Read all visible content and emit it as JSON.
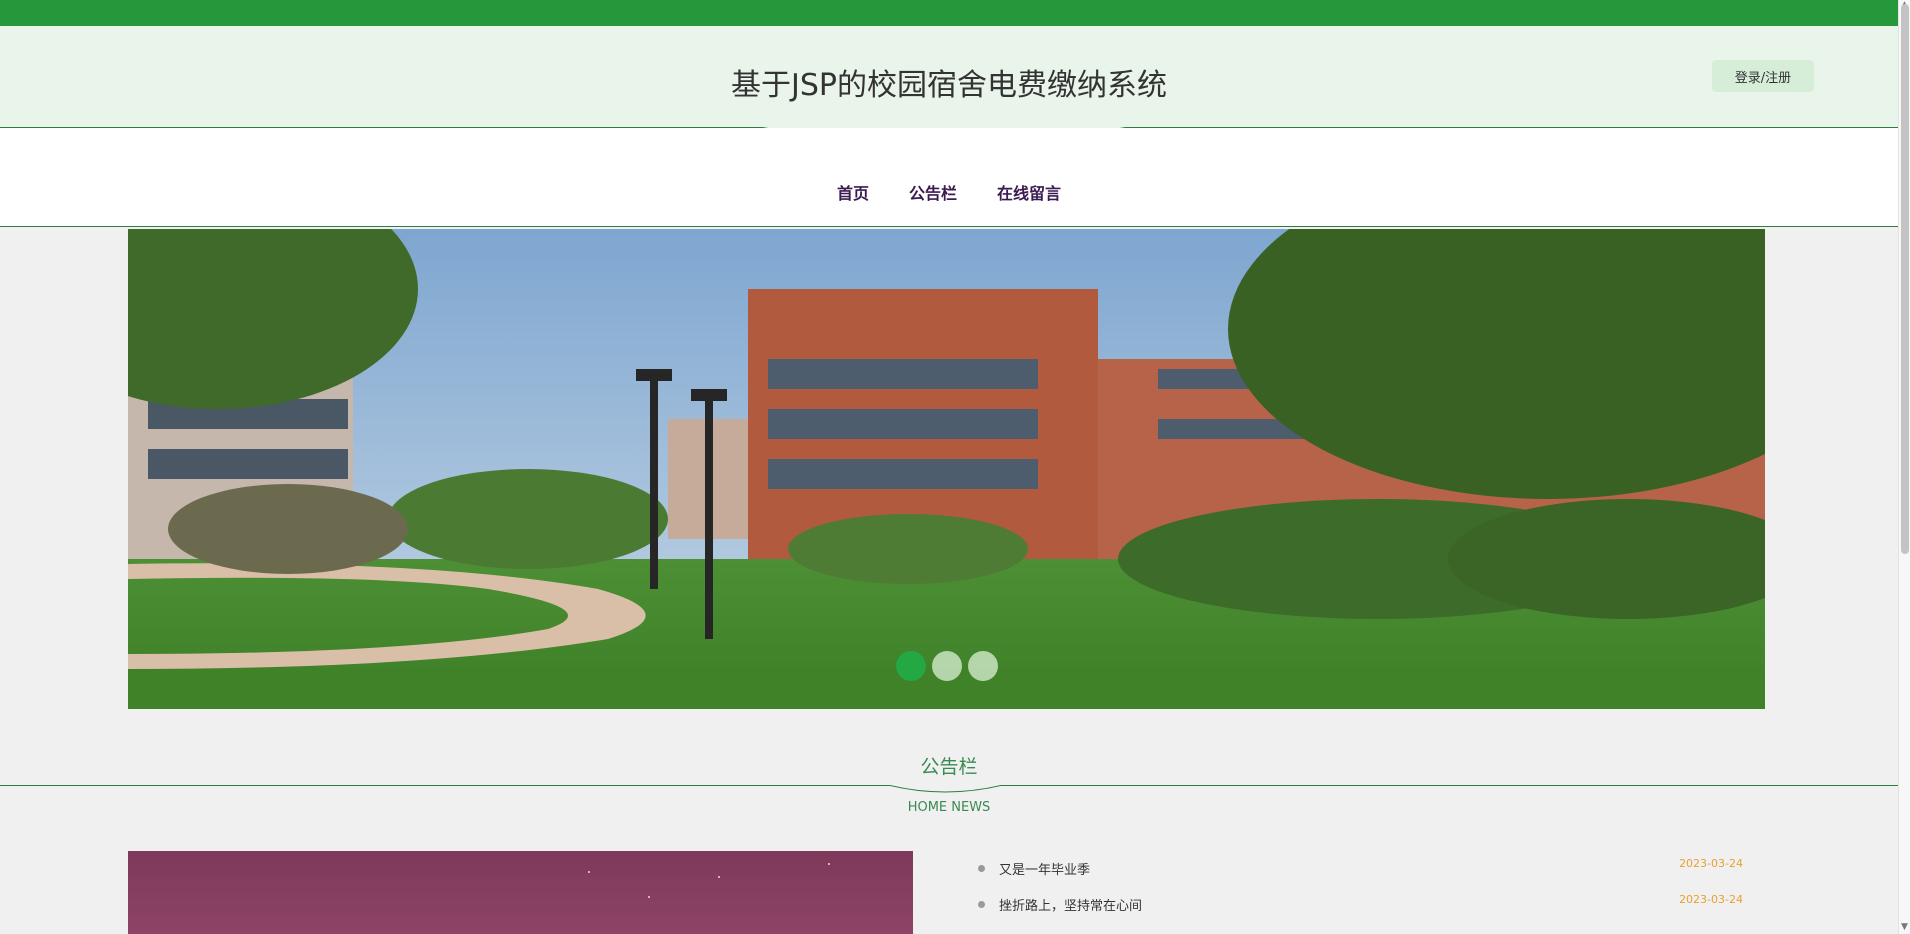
{
  "header": {
    "title": "基于JSP的校园宿舍电费缴纳系统",
    "login_label": "登录/注册"
  },
  "nav": {
    "items": [
      {
        "label": "首页",
        "active": true
      },
      {
        "label": "公告栏",
        "active": false
      },
      {
        "label": "在线留言",
        "active": false
      }
    ]
  },
  "banner": {
    "slide_count": 3,
    "active_slide": 1
  },
  "notice_section": {
    "title": "公告栏",
    "subtitle": "HOME NEWS",
    "items": [
      {
        "title": "又是一年毕业季",
        "date": "2023-03-24"
      },
      {
        "title": "挫折路上，坚持常在心间",
        "date": "2023-03-24"
      }
    ]
  },
  "colors": {
    "brand_green": "#26983c",
    "header_bg": "#e9f4ea",
    "nav_text": "#3a1a50",
    "section_green": "#3a8a53",
    "date_orange": "#e8a030"
  }
}
